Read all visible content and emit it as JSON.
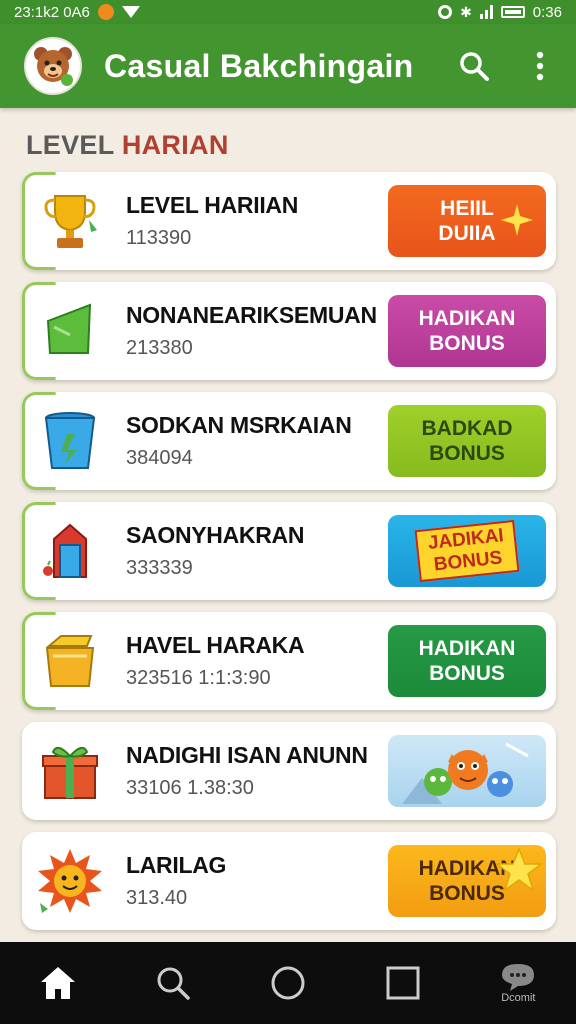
{
  "status_bar": {
    "left_text": "23:1k2 0A6",
    "right_text": "0:36"
  },
  "app_bar": {
    "title": "Casual Bakchingain"
  },
  "section": {
    "title_part1": "LEVEL ",
    "title_part2": "HARIAN"
  },
  "items": [
    {
      "name": "LEVEL HARIIAN",
      "number": "113390",
      "button_line1": "HEIIL",
      "button_line2": "DUIIA",
      "icon": "trophy-icon"
    },
    {
      "name": "NONANEARIKSEMUAN",
      "number": "213380",
      "button_line1": "HADIKAN",
      "button_line2": "BONUS",
      "icon": "green-flag-icon"
    },
    {
      "name": "SODKAN MSRKAIAN",
      "number": "384094",
      "button_line1": "BADKAD",
      "button_line2": "BONUS",
      "icon": "blue-bucket-icon"
    },
    {
      "name": "SAONYHAKRAN",
      "number": "333339",
      "button_line1": "JADIKAI",
      "button_line2": "BONUS",
      "icon": "house-icon"
    },
    {
      "name": "HAVEL HARAKA",
      "number": "323516 1:1:3:90",
      "button_line1": "HADIKAN",
      "button_line2": "BONUS",
      "icon": "honey-pot-icon"
    },
    {
      "name": "NADIGHI ISAN ANUNN",
      "number": "33106 1.38:30",
      "button_line1": "",
      "button_line2": "",
      "icon": "gift-box-icon"
    },
    {
      "name": "LARILAG",
      "number": "313.40",
      "button_line1": "HADIKAN",
      "button_line2": "BONUS",
      "icon": "sun-icon"
    }
  ],
  "nav": {
    "last_label": "Dcomit"
  },
  "colors": {
    "primary_green": "#43962f",
    "background": "#f3ece2",
    "section_accent": "#b0402f"
  }
}
